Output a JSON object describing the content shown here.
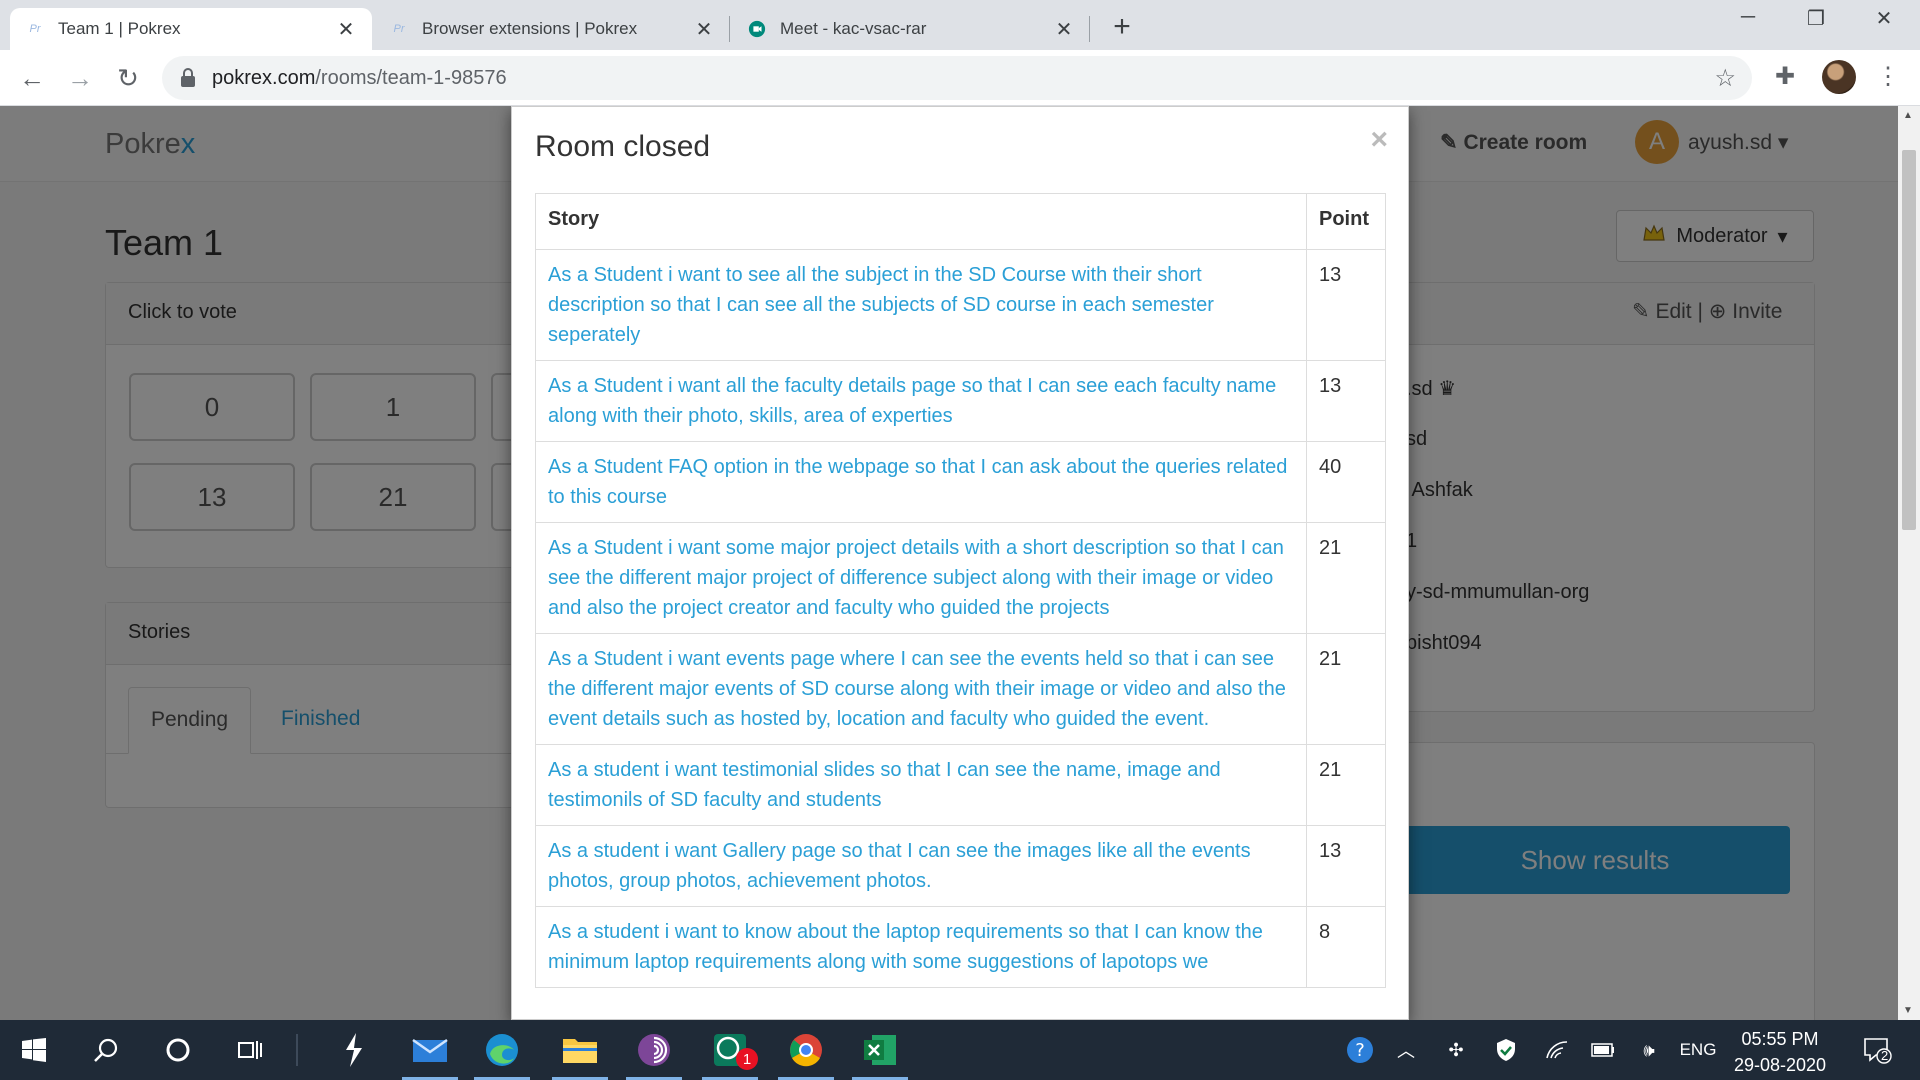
{
  "browser": {
    "tabs": [
      {
        "title": "Team 1 | Pokrex",
        "favicon": "Pr"
      },
      {
        "title": "Browser extensions | Pokrex",
        "favicon": "Pr"
      },
      {
        "title": "Meet - kac-vsac-rar",
        "favicon": "meet-icon"
      }
    ],
    "url_domain": "pokrex.com",
    "url_path": "/rooms/team-1-98576"
  },
  "navbar": {
    "brand_main": "Pokre",
    "brand_accent": "x",
    "create_room": "Create room",
    "avatar_letter": "A",
    "user": "ayush.sd"
  },
  "room": {
    "title": "Team 1",
    "moderator": "Moderator",
    "vote_heading": "Click to vote",
    "cards": [
      "0",
      "1",
      "13",
      "21"
    ],
    "stories_heading": "Stories",
    "tab_pending": "Pending",
    "tab_finished": "Finished",
    "edit": "Edit",
    "separator": "|",
    "invite": "Invite",
    "players": [
      ".sd",
      "sd",
      " Ashfak",
      "1",
      "y-sd-mmumullan-org",
      "bisht094"
    ],
    "show_results": "Show results"
  },
  "modal": {
    "title": "Room closed",
    "close": "×",
    "col_story": "Story",
    "col_point": "Point",
    "rows": [
      {
        "story": "As a Student i want to see all the subject in the SD Course with their short description so that I can see all the subjects of SD course in each semester seperately",
        "point": "13"
      },
      {
        "story": "As a Student i want all the faculty details page so that I can see each faculty name along with their photo, skills, area of experties",
        "point": "13"
      },
      {
        "story": "As a Student FAQ option in the webpage so that I can ask about the queries related to this course",
        "point": "40"
      },
      {
        "story": "As a Student i want some major project details with a short description so that I can see the different major project of difference subject along with their image or video and also the project creator and faculty who guided the projects",
        "point": "21"
      },
      {
        "story": "As a Student i want events page where I can see the events held so that i can see the different major events of SD course along with their image or video and also the event details such as hosted by, location and faculty who guided the event.",
        "point": "21"
      },
      {
        "story": "As a student i want testimonial slides so that I can see the name, image and testimonils of SD faculty and students",
        "point": "21"
      },
      {
        "story": "As a student i want Gallery page so that I can see the images like all the events photos, group photos, achievement photos.",
        "point": "13"
      },
      {
        "story": "As a student i want to know about the laptop requirements so that I can know the minimum laptop requirements along with some suggestions of lapotops we",
        "point": "8"
      }
    ]
  },
  "taskbar": {
    "lang": "ENG",
    "time": "05:55 PM",
    "date": "29-08-2020",
    "notifications": "2",
    "whatsapp_badge": "1"
  },
  "colors": {
    "accent": "#2a9fd6",
    "avatar": "#e8a13a",
    "taskbar": "#1f2a37"
  }
}
